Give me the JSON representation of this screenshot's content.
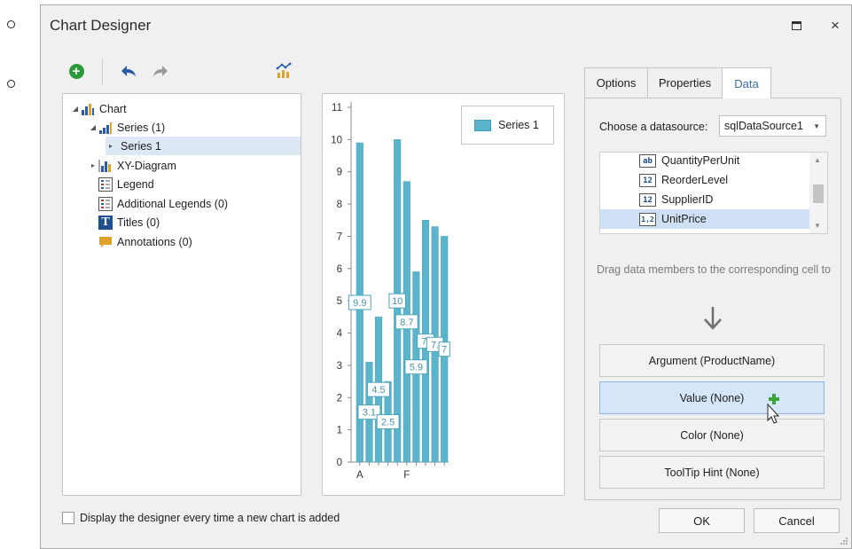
{
  "window": {
    "title": "Chart Designer",
    "maximize": "□",
    "close": "×"
  },
  "toolbar": {
    "add_icon": "plus-circle-icon",
    "undo_icon": "undo-arrow-icon",
    "redo_icon": "redo-arrow-icon",
    "wizard_icon": "chart-wizard-icon"
  },
  "tree": {
    "items": [
      {
        "label": "Chart",
        "expanded": true,
        "icon": "chart-icon"
      },
      {
        "label": "Series (1)",
        "expanded": true,
        "icon": "series-collection-icon"
      },
      {
        "label": "Series 1",
        "selected": true
      },
      {
        "label": "XY-Diagram",
        "expanded": false,
        "icon": "diagram-icon"
      },
      {
        "label": "Legend",
        "icon": "legend-icon"
      },
      {
        "label": "Additional Legends (0)",
        "icon": "legends-icon"
      },
      {
        "label": "Titles (0)",
        "icon": "title-icon",
        "glyph": "T"
      },
      {
        "label": "Annotations (0)",
        "icon": "annotation-icon"
      }
    ]
  },
  "chart_data": {
    "type": "bar",
    "series": [
      {
        "name": "Series 1",
        "values": [
          9.9,
          3.1,
          4.5,
          2.5,
          10,
          8.7,
          5.9,
          7.5,
          7.3,
          7.0
        ]
      }
    ],
    "value_labels": [
      "9.9",
      "3.1",
      "4.5",
      "2.5",
      "10",
      "8.7",
      "5.9",
      "7.",
      "7.",
      "7"
    ],
    "x_tick_labels": [
      "A",
      "F"
    ],
    "y_ticks": [
      "0",
      "1",
      "2",
      "3",
      "4",
      "5",
      "6",
      "7",
      "8",
      "9",
      "10",
      "11"
    ],
    "ylim": [
      0,
      11
    ],
    "legend": {
      "position": "top-right",
      "color": "#5ab4cb"
    },
    "grid": false
  },
  "tabs": [
    {
      "label": "Options",
      "active": false
    },
    {
      "label": "Properties",
      "active": false
    },
    {
      "label": "Data",
      "active": true
    }
  ],
  "data_tab": {
    "datasource_label": "Choose a datasource:",
    "datasource_value": "sqlDataSource1",
    "fields": [
      {
        "icon_text": "ab",
        "name": "QuantityPerUnit",
        "selected": false
      },
      {
        "icon_text": "12",
        "name": "ReorderLevel",
        "selected": false
      },
      {
        "icon_text": "12",
        "name": "SupplierID",
        "selected": false
      },
      {
        "icon_text": "1,2",
        "name": "UnitPrice",
        "selected": true
      }
    ],
    "hint": "Drag data members to the corresponding cell to",
    "cells": [
      {
        "label": "Argument (ProductName)",
        "hover": false
      },
      {
        "label": "Value (None)",
        "hover": true
      },
      {
        "label": "Color (None)",
        "hover": false
      },
      {
        "label": "ToolTip Hint (None)",
        "hover": false
      }
    ]
  },
  "footer": {
    "checkbox_label": "Display the designer every time a new chart is added",
    "ok": "OK",
    "cancel": "Cancel"
  },
  "colors": {
    "bar": "#5ab4cb",
    "accent": "#3b6fb6",
    "selection": "#cfe0f4"
  }
}
